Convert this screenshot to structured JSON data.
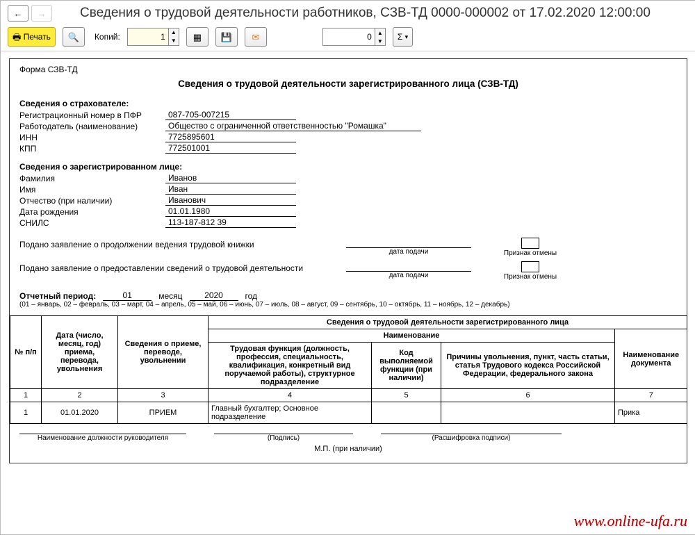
{
  "header": {
    "title": "Сведения о трудовой деятельности работников, СЗВ-ТД 0000-000002 от 17.02.2020 12:00:00"
  },
  "toolbar": {
    "print_label": "Печать",
    "copies_label": "Копий:",
    "copies_value": "1",
    "zero_value": "0",
    "sigma": "Σ",
    "icons": {
      "printer": "🖶",
      "search": "🔍",
      "grid": "▦",
      "save": "💾",
      "mail": "✉"
    }
  },
  "doc": {
    "form_code": "Форма СЗВ-ТД",
    "title": "Сведения о трудовой деятельности зарегистрированного лица (СЗВ-ТД)",
    "insurer_section": "Сведения о страхователе:",
    "insurer": {
      "reg_label": "Регистрационный номер в ПФР",
      "reg_value": "087-705-007215",
      "employer_label": "Работодатель (наименование)",
      "employer_value": "Общество с ограниченной ответственностью \"Ромашка\"",
      "inn_label": "ИНН",
      "inn_value": "7725895601",
      "kpp_label": "КПП",
      "kpp_value": "772501001"
    },
    "person_section": "Сведения о зарегистрированном лице:",
    "person": {
      "lastname_label": "Фамилия",
      "lastname": "Иванов",
      "firstname_label": "Имя",
      "firstname": "Иван",
      "patronymic_label": "Отчество (при наличии)",
      "patronymic": "Иванович",
      "birth_label": "Дата рождения",
      "birth": "01.01.1980",
      "snils_label": "СНИЛС",
      "snils": "113-187-812 39"
    },
    "statements": {
      "s1": "Подано заявление о продолжении ведения трудовой книжки",
      "s2": "Подано заявление о предоставлении сведений о трудовой деятельности",
      "date_caption": "дата подачи",
      "flag_caption": "Признак отмены"
    },
    "period": {
      "label": "Отчетный период:",
      "month": "01",
      "month_word": "месяц",
      "year": "2020",
      "year_word": "год",
      "note": "(01 – январь, 02 – февраль, 03 – март, 04 – апрель, 05 – май, 06 – июнь, 07 – июль, 08 – август, 09 – сентябрь, 10 – октябрь, 11 – ноябрь, 12 – декабрь)"
    },
    "table": {
      "top_header": "Сведения о трудовой деятельности зарегистрированного лица",
      "sub_header": "Наименование",
      "cols": {
        "c1": "№ п/п",
        "c2": "Дата (число, месяц, год) приема, перевода, увольнения",
        "c3": "Сведения о приеме, переводе, увольнении",
        "c4": "Трудовая функция (должность, профессия, специальность, квалификация, конкретный вид поручаемой работы), структурное подразделение",
        "c5": "Код выполняемой функции (при наличии)",
        "c6": "Причины увольнения, пункт, часть статьи, статья Трудового кодекса Российской Федерации, федерального закона",
        "c7": "Наименование документа"
      },
      "num_row": {
        "n1": "1",
        "n2": "2",
        "n3": "3",
        "n4": "4",
        "n5": "5",
        "n6": "6",
        "n7": "7"
      },
      "data_row": {
        "r1": "1",
        "r2": "01.01.2020",
        "r3": "ПРИЕМ",
        "r4": "Главный бухгалтер; Основное подразделение",
        "r5": "",
        "r6": "",
        "r7": "Прика"
      }
    },
    "signatures": {
      "s1": "Наименование должности руководителя",
      "s2": "(Подпись)",
      "s3": "(Расшифровка подписи)",
      "mp": "М.П. (при наличии)"
    }
  },
  "watermark": "www.online-ufa.ru"
}
